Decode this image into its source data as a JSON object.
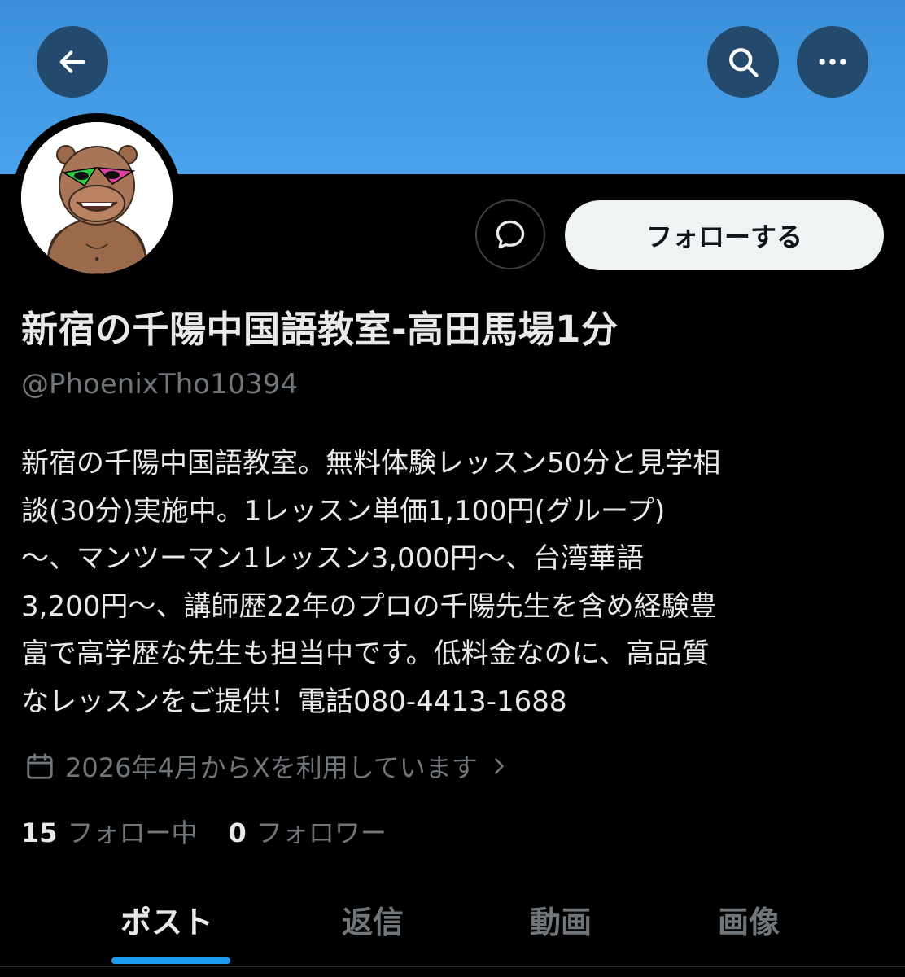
{
  "header": {
    "back_icon": "arrow-left-icon",
    "search_icon": "search-icon",
    "more_icon": "more-horizontal-icon"
  },
  "profile": {
    "avatar": "bear-with-sunglasses-avatar",
    "message_icon": "message-bubble-icon",
    "follow_label": "フォローする",
    "name": "新宿の千陽中国語教室-高田馬場1分",
    "handle": "@PhoenixTho10394",
    "bio": "新宿の千陽中国語教室。無料体験レッスン50分と見学相\n談(30分)実施中。1レッスン単価1,100円(グループ)\n〜、マンツーマン1レッスン3,000円〜、台湾華語\n 3,200円〜、講師歴22年のプロの千陽先生を含め経験豊\n富で高学歴な先生も担当中です。低料金なのに、高品質\nなレッスンをご提供！電話080-4413-1688",
    "joined": "2026年4月からXを利用しています",
    "following_count": "15",
    "following_label": "フォロー中",
    "followers_count": "0",
    "followers_label": "フォロワー"
  },
  "tabs": [
    {
      "label": "ポスト",
      "active": true
    },
    {
      "label": "返信",
      "active": false
    },
    {
      "label": "動画",
      "active": false
    },
    {
      "label": "画像",
      "active": false
    }
  ],
  "colors": {
    "banner": "#4aa3ec",
    "accent": "#1d9bf0"
  }
}
